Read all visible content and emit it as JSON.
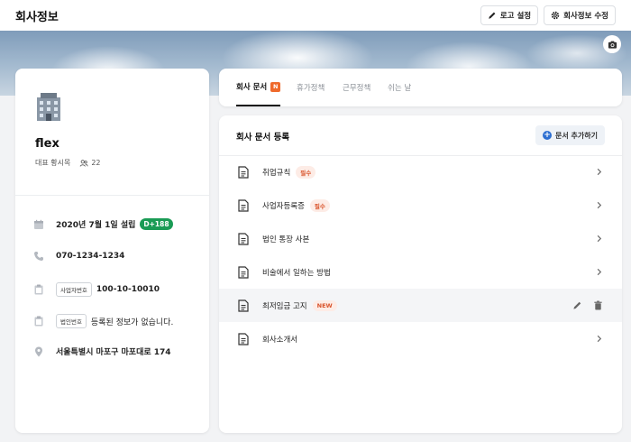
{
  "header": {
    "title": "회사정보",
    "logo_button": "로고 설정",
    "edit_button": "회사정보 수정"
  },
  "company": {
    "name": "flex",
    "ceo": "대표 황시목",
    "employees": "22"
  },
  "info": {
    "founded": "2020년 7월 1일 설립",
    "dday": "D+188",
    "phone": "070-1234-1234",
    "biz_tag": "사업자번호",
    "biz_number": "100-10-10010",
    "corp_tag": "법인번호",
    "corp_value": "등록된 정보가 없습니다.",
    "address": "서울특별시 마포구 마포대로 174"
  },
  "tabs": [
    {
      "label": "회사 문서",
      "badge": "N"
    },
    {
      "label": "휴가정책"
    },
    {
      "label": "근무정책"
    },
    {
      "label": "쉬는 날"
    }
  ],
  "docs": {
    "title": "회사 문서 등록",
    "add_button": "문서 추가하기",
    "required_label": "필수",
    "new_label": "NEW",
    "items": [
      {
        "label": "취업규칙"
      },
      {
        "label": "사업자등록증"
      },
      {
        "label": "법인 통장 사본"
      },
      {
        "label": "비술에서 일하는 방법"
      },
      {
        "label": "최저임금 고지"
      },
      {
        "label": "회사소개서"
      }
    ]
  },
  "colors": {
    "accent_green": "#1a9b55",
    "badge_orange": "#ef6a2c",
    "tag_red": "#d9532b",
    "add_blue": "#2d6fd1"
  }
}
